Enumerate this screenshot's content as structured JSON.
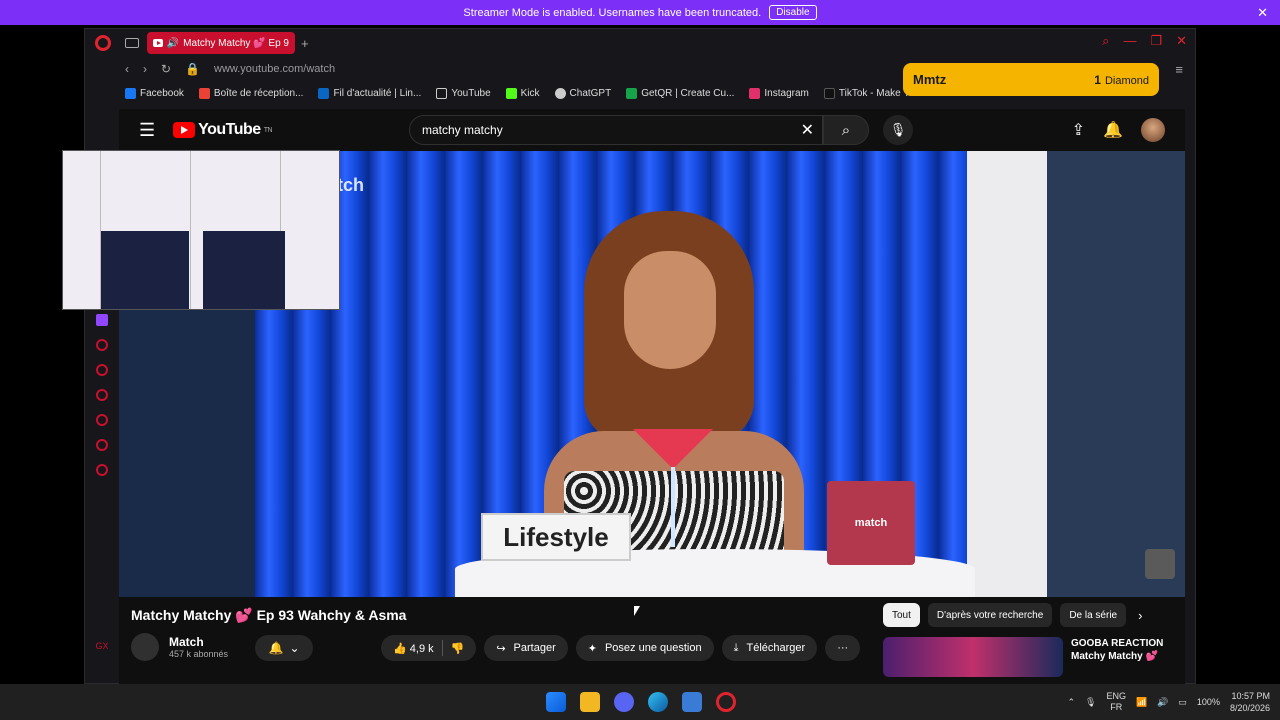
{
  "banner": {
    "message": "Streamer Mode is enabled. Usernames have been truncated.",
    "disable_label": "Disable",
    "close": "✕"
  },
  "browser": {
    "tab_title": "Matchy Matchy 💕 Ep 9",
    "tab_add": "+",
    "url": "www.youtube.com/watch",
    "bookmarks": [
      {
        "label": "Facebook",
        "color": "#1877f2"
      },
      {
        "label": "Boîte de réception...",
        "color": "#ea4335"
      },
      {
        "label": "Fil d'actualité | Lin...",
        "color": "#0a66c2"
      },
      {
        "label": "YouTube",
        "color": "#cccccc"
      },
      {
        "label": "Kick",
        "color": "#53fc18"
      },
      {
        "label": "ChatGPT",
        "color": "#cccccc"
      },
      {
        "label": "GetQR | Create Cu...",
        "color": "#16a34a"
      },
      {
        "label": "Instagram",
        "color": "#e1306c"
      },
      {
        "label": "TikTok - Make You...",
        "color": "#111111"
      }
    ]
  },
  "youtube": {
    "logo_text": "YouTube",
    "logo_sup": "TN",
    "search_value": "matchy matchy",
    "video": {
      "card_text": "Lifestyle",
      "box_text": "match",
      "watermark": "tch"
    },
    "title": "Matchy Matchy 💕 Ep 93 Wahchy & Asma",
    "channel_name": "Match",
    "channel_subs": "457 k abonnés",
    "likes": "4,9 k",
    "share_label": "Partager",
    "ask_label": "Posez une question",
    "download_label": "Télécharger",
    "more": "···",
    "chips": [
      "Tout",
      "D'après votre recherche",
      "De la série"
    ],
    "rec_title_1": "GOOBA REACTION",
    "rec_title_2": "Matchy Matchy 💕"
  },
  "notification": {
    "name": "Mmtz",
    "count": "1",
    "gift": "Diamond"
  },
  "sidebar_bottom": "GX",
  "taskbar": {
    "lang_1": "ENG",
    "lang_2": "FR",
    "battery": "100%",
    "time": "10:57 PM",
    "date": "8/20/2026"
  }
}
